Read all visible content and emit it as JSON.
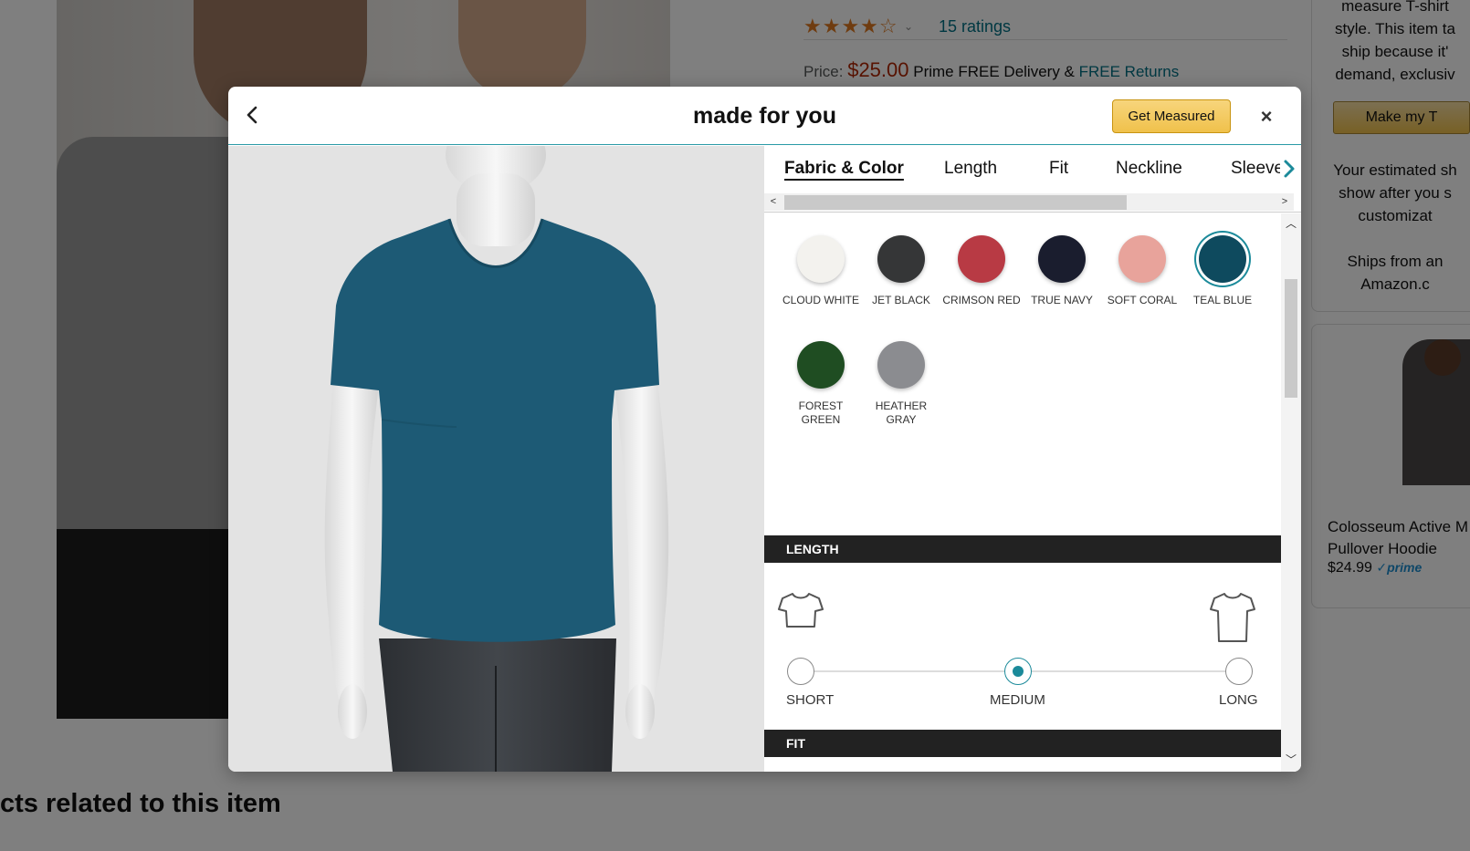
{
  "background": {
    "ratings_text": "15 ratings",
    "stars": "★★★★☆",
    "price_label": "Price:",
    "price_amount": "$25.00",
    "price_delivery": "Prime FREE Delivery &",
    "price_returns": "FREE Returns",
    "right_text_lines": [
      "measure T-shirt",
      "style. This item ta",
      "ship because it'",
      "demand, exclusiv"
    ],
    "make_button": "Make my T",
    "estimate_lines": [
      "Your estimated sh",
      "show after you s",
      "customizat"
    ],
    "ships_lines": [
      "Ships from an",
      "Amazon.c"
    ],
    "card_title_lines": [
      "Colosseum Active M",
      "Pullover Hoodie"
    ],
    "card_price": "$24.99",
    "card_prime": "✓prime",
    "related_title": "cts related to this item"
  },
  "modal": {
    "title": "made for you",
    "get_measured": "Get Measured",
    "close": "×"
  },
  "tabs": [
    {
      "label": "Fabric & Color",
      "active": true
    },
    {
      "label": "Length",
      "active": false
    },
    {
      "label": "Fit",
      "active": false
    },
    {
      "label": "Neckline",
      "active": false
    },
    {
      "label": "Sleeve",
      "active": false
    }
  ],
  "colors": [
    {
      "name": "CLOUD WHITE",
      "hex": "#f3f2ee",
      "selected": false
    },
    {
      "name": "JET BLACK",
      "hex": "#353637",
      "selected": false
    },
    {
      "name": "CRIMSON RED",
      "hex": "#b83a44",
      "selected": false
    },
    {
      "name": "TRUE NAVY",
      "hex": "#1a1d2e",
      "selected": false
    },
    {
      "name": "SOFT CORAL",
      "hex": "#e8a39b",
      "selected": false
    },
    {
      "name": "TEAL BLUE",
      "hex": "#0e4a5e",
      "selected": true
    },
    {
      "name": "FOREST GREEN",
      "hex": "#1f4d22",
      "selected": false
    },
    {
      "name": "HEATHER GRAY",
      "hex": "#8b8c90",
      "selected": false
    }
  ],
  "length": {
    "title": "LENGTH",
    "options": [
      "SHORT",
      "MEDIUM",
      "LONG"
    ],
    "selected": "MEDIUM"
  },
  "fit": {
    "title": "FIT"
  },
  "accent_color": "#1b8a9a",
  "shirt_color": "#1d5a75"
}
